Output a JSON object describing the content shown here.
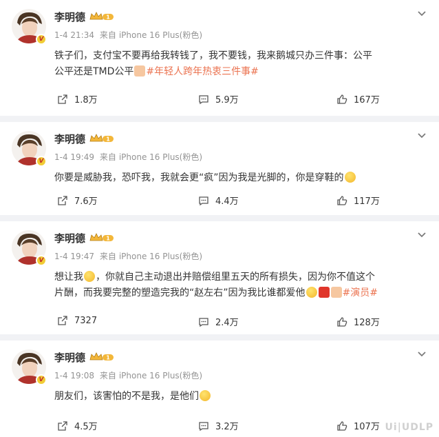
{
  "posts": [
    {
      "name": "李明德",
      "time": "1-4 21:34",
      "source_prefix": "来自",
      "source": "iPhone 16 Plus(粉色)",
      "text_a": "铁子们，支付宝不要再给我转钱了，我不要钱，我来鹅城只办三件事：公平 公平还是TMD公平",
      "emoji_a": "cake-emoji",
      "tag": "#年轻人跨年热衷三件事#",
      "share_count": "1.8万",
      "comment_count": "5.9万",
      "like_count": "167万"
    },
    {
      "name": "李明德",
      "time": "1-4 19:49",
      "source_prefix": "来自",
      "source": "iPhone 16 Plus(粉色)",
      "text_a": "你要是威胁我，恐吓我，我就会更“疯”因为我是光脚的，你是穿鞋的",
      "emoji_a": "grin-emoji",
      "share_count": "7.6万",
      "comment_count": "4.4万",
      "like_count": "117万"
    },
    {
      "name": "李明德",
      "time": "1-4 19:47",
      "source_prefix": "来自",
      "source": "iPhone 16 Plus(粉色)",
      "text_a": "想让我",
      "text_b": "，你就自己主动退出并赔偿组里五天的所有损失，因为你不值这个片酬，而我要完整的塑造完我的“赵左右”因为我比谁都爱他",
      "tag": "#演员#",
      "share_count": "7327",
      "comment_count": "2.4万",
      "like_count": "128万"
    },
    {
      "name": "李明德",
      "time": "1-4 19:08",
      "source_prefix": "来自",
      "source": "iPhone 16 Plus(粉色)",
      "text_a": "朋友们，该害怕的不是我，是他们",
      "emoji_a": "smile-emoji",
      "share_count": "4.5万",
      "comment_count": "3.2万",
      "like_count": "107万"
    }
  ],
  "watermark": "Ui|UDLP",
  "colors": {
    "background": "#f1f2f5",
    "card": "#ffffff",
    "tag": "#eb7350",
    "meta": "#939393",
    "badge": "#f1cc35"
  }
}
